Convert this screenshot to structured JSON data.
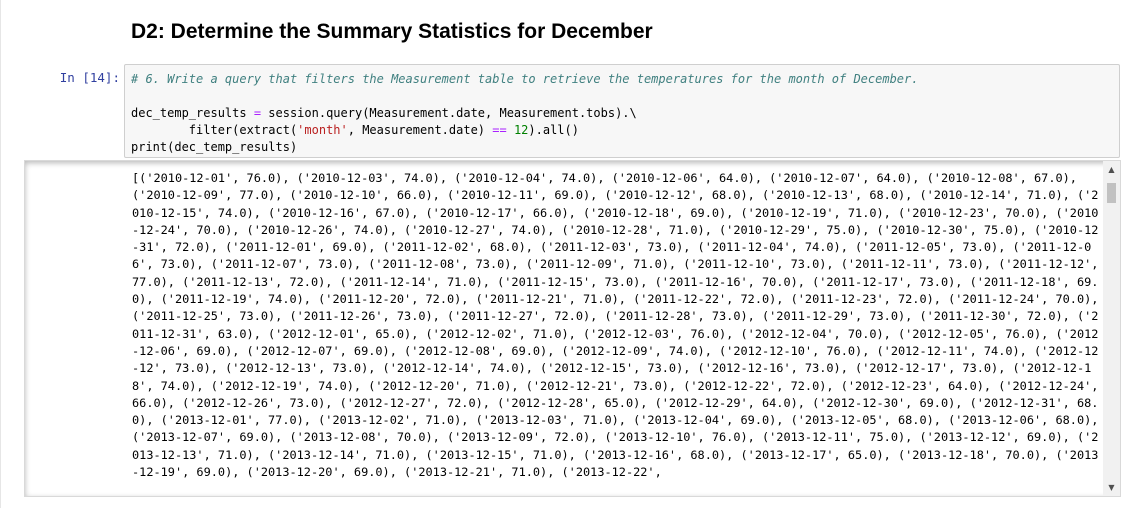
{
  "markdown": {
    "heading": "D2: Determine the Summary Statistics for December"
  },
  "cell": {
    "prompt": "In [14]:",
    "code": {
      "comment": "# 6. Write a query that filters the Measurement table to retrieve the temperatures for the month of December.",
      "line2_a": "dec_temp_results ",
      "line2_op": "=",
      "line2_b": " session.query(Measurement.date, Measurement.tobs).\\",
      "line3_a": "        filter(extract(",
      "line3_str": "'month'",
      "line3_b": ", Measurement.date) ",
      "line3_op": "==",
      "line3_sp": " ",
      "line3_num": "12",
      "line3_c": ").all()",
      "line4": "print(dec_temp_results)"
    },
    "output": "[('2010-12-01', 76.0), ('2010-12-03', 74.0), ('2010-12-04', 74.0), ('2010-12-06', 64.0), ('2010-12-07', 64.0), ('2010-12-08', 67.0), ('2010-12-09', 77.0), ('2010-12-10', 66.0), ('2010-12-11', 69.0), ('2010-12-12', 68.0), ('2010-12-13', 68.0), ('2010-12-14', 71.0), ('2010-12-15', 74.0), ('2010-12-16', 67.0), ('2010-12-17', 66.0), ('2010-12-18', 69.0), ('2010-12-19', 71.0), ('2010-12-23', 70.0), ('2010-12-24', 70.0), ('2010-12-26', 74.0), ('2010-12-27', 74.0), ('2010-12-28', 71.0), ('2010-12-29', 75.0), ('2010-12-30', 75.0), ('2010-12-31', 72.0), ('2011-12-01', 69.0), ('2011-12-02', 68.0), ('2011-12-03', 73.0), ('2011-12-04', 74.0), ('2011-12-05', 73.0), ('2011-12-06', 73.0), ('2011-12-07', 73.0), ('2011-12-08', 73.0), ('2011-12-09', 71.0), ('2011-12-10', 73.0), ('2011-12-11', 73.0), ('2011-12-12', 77.0), ('2011-12-13', 72.0), ('2011-12-14', 71.0), ('2011-12-15', 73.0), ('2011-12-16', 70.0), ('2011-12-17', 73.0), ('2011-12-18', 69.0), ('2011-12-19', 74.0), ('2011-12-20', 72.0), ('2011-12-21', 71.0), ('2011-12-22', 72.0), ('2011-12-23', 72.0), ('2011-12-24', 70.0), ('2011-12-25', 73.0), ('2011-12-26', 73.0), ('2011-12-27', 72.0), ('2011-12-28', 73.0), ('2011-12-29', 73.0), ('2011-12-30', 72.0), ('2011-12-31', 63.0), ('2012-12-01', 65.0), ('2012-12-02', 71.0), ('2012-12-03', 76.0), ('2012-12-04', 70.0), ('2012-12-05', 76.0), ('2012-12-06', 69.0), ('2012-12-07', 69.0), ('2012-12-08', 69.0), ('2012-12-09', 74.0), ('2012-12-10', 76.0), ('2012-12-11', 74.0), ('2012-12-12', 73.0), ('2012-12-13', 73.0), ('2012-12-14', 74.0), ('2012-12-15', 73.0), ('2012-12-16', 73.0), ('2012-12-17', 73.0), ('2012-12-18', 74.0), ('2012-12-19', 74.0), ('2012-12-20', 71.0), ('2012-12-21', 73.0), ('2012-12-22', 72.0), ('2012-12-23', 64.0), ('2012-12-24', 66.0), ('2012-12-26', 73.0), ('2012-12-27', 72.0), ('2012-12-28', 65.0), ('2012-12-29', 64.0), ('2012-12-30', 69.0), ('2012-12-31', 68.0), ('2013-12-01', 77.0), ('2013-12-02', 71.0), ('2013-12-03', 71.0), ('2013-12-04', 69.0), ('2013-12-05', 68.0), ('2013-12-06', 68.0), ('2013-12-07', 69.0), ('2013-12-08', 70.0), ('2013-12-09', 72.0), ('2013-12-10', 76.0), ('2013-12-11', 75.0), ('2013-12-12', 69.0), ('2013-12-13', 71.0), ('2013-12-14', 71.0), ('2013-12-15', 71.0), ('2013-12-16', 68.0), ('2013-12-17', 65.0), ('2013-12-18', 70.0), ('2013-12-19', 69.0), ('2013-12-20', 69.0), ('2013-12-21', 71.0), ('2013-12-22',"
  },
  "scrollbar": {
    "up_icon": "scroll-up-arrow-icon",
    "down_icon": "scroll-down-arrow-icon"
  }
}
